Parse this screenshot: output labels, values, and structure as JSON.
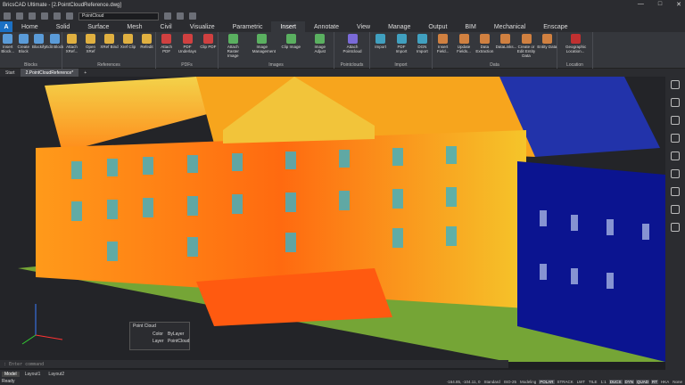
{
  "titlebar": {
    "app_name": "BricsCAD Ultimate - [2.PointCloudReference.dwg]"
  },
  "qat": {
    "layer_selector": "PointCloud"
  },
  "ribbon_tabs": [
    "Home",
    "Solid",
    "Surface",
    "Mesh",
    "Civil",
    "Visualize",
    "Parametric",
    "Insert",
    "Annotate",
    "View",
    "Manage",
    "Output",
    "BIM",
    "Mechanical",
    "Enscape"
  ],
  "active_tab": "Insert",
  "ribbon": {
    "groups": [
      {
        "label": "Blocks",
        "buttons": [
          "Insert Block...",
          "Create Block",
          "Blockify",
          "Edit Block"
        ]
      },
      {
        "label": "References",
        "buttons": [
          "Attach XRef...",
          "Open XRef",
          "XRef Bind",
          "Xref Clip",
          "Refedit"
        ]
      },
      {
        "label": "PDFs",
        "buttons": [
          "Attach PDF",
          "PDF Underlays",
          "Clip PDF"
        ]
      },
      {
        "label": "Images",
        "buttons": [
          "Attach Raster Image",
          "Image Management",
          "Clip Image",
          "Image Adjust"
        ]
      },
      {
        "label": "Pointclouds",
        "buttons": [
          "Attach Pointcloud"
        ]
      },
      {
        "label": "Import",
        "buttons": [
          "Import",
          "PDF Import",
          "DGN Import"
        ]
      },
      {
        "label": "Data",
        "buttons": [
          "Insert Field...",
          "Update Fields...",
          "Data Extraction",
          "DataLinks...",
          "Create or Edit Entity Data",
          "Entity Data"
        ]
      },
      {
        "label": "Location",
        "buttons": [
          "Geographic Location..."
        ]
      }
    ]
  },
  "doc_tabs": [
    "Start",
    "2.PointCloudReference*"
  ],
  "cmdline": {
    "placeholder": ": Enter command"
  },
  "panel": {
    "title": "Point Cloud",
    "color_label": "Color",
    "color_value": "ByLayer",
    "layer_label": "Layer",
    "layer_value": "PointCloud"
  },
  "layout_tabs": [
    "Model",
    "Layout1",
    "Layout2"
  ],
  "status": {
    "ready": "Ready",
    "coords": "-164.85, -104.11, 0",
    "items": [
      "Standard",
      "ISO-25",
      "Modeling",
      "POLAR",
      "STRACK",
      "LWT",
      "TILE",
      "1:1",
      "DUCS",
      "DYN",
      "QUAD",
      "RT",
      "HKA",
      "None"
    ]
  }
}
